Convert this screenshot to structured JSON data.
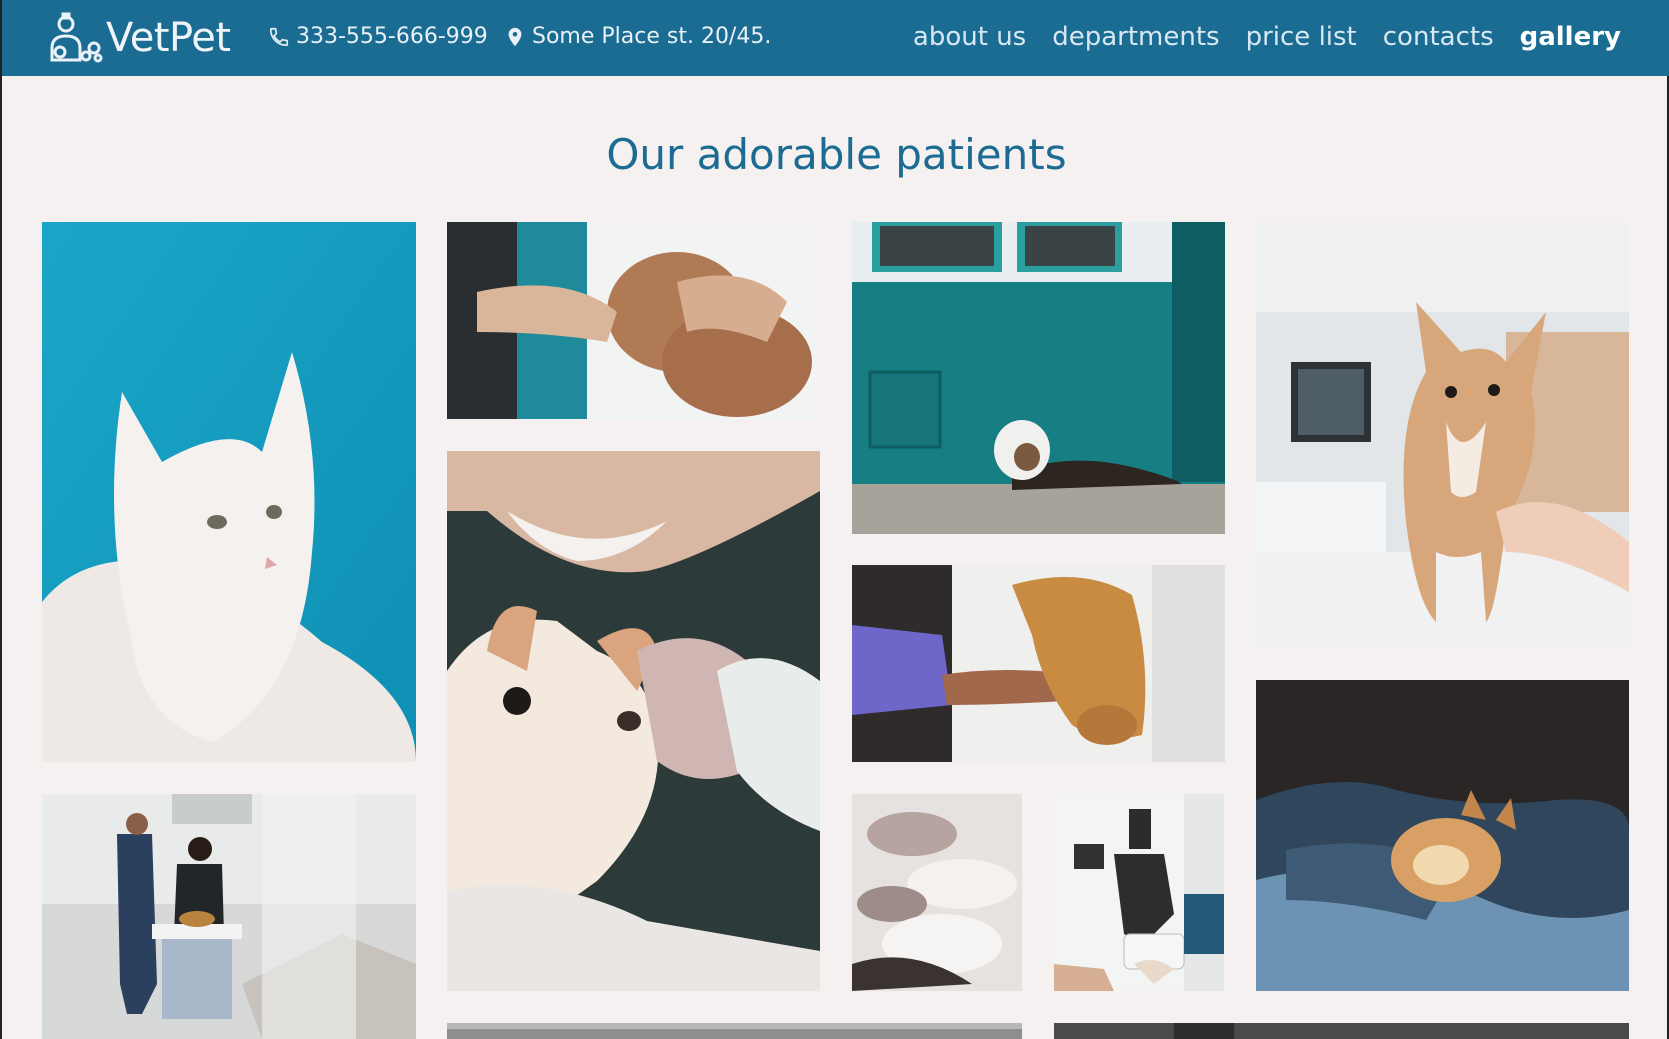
{
  "header": {
    "logo_text": "VetPet",
    "phone": "333-555-666-999",
    "address": "Some Place st. 20/45.",
    "icons": {
      "logo": "vet-pet-logo-icon",
      "phone": "phone-icon",
      "address": "map-pin-icon"
    }
  },
  "nav": {
    "items": [
      {
        "label": "about us"
      },
      {
        "label": "departments"
      },
      {
        "label": "price list"
      },
      {
        "label": "contacts"
      },
      {
        "label": "gallery"
      }
    ],
    "active": "gallery"
  },
  "page": {
    "title": "Our adorable patients"
  },
  "colors": {
    "brand": "#1b6c93",
    "background": "#f5f1f1",
    "title": "#1c6b92"
  },
  "gallery": {
    "photos": [
      {
        "subject": "white cat on blue background"
      },
      {
        "subject": "hands holding brown poodle puppy"
      },
      {
        "subject": "dog with cone lying by teal wall"
      },
      {
        "subject": "chihuahua on exam table"
      },
      {
        "subject": "chihuahua sniffing newborn puppy"
      },
      {
        "subject": "vet examining golden dog"
      },
      {
        "subject": "vets with dog in x-ray room"
      },
      {
        "subject": "newborn puppies"
      },
      {
        "subject": "lab microscope"
      },
      {
        "subject": "cat in blanket in sunlight"
      }
    ]
  }
}
